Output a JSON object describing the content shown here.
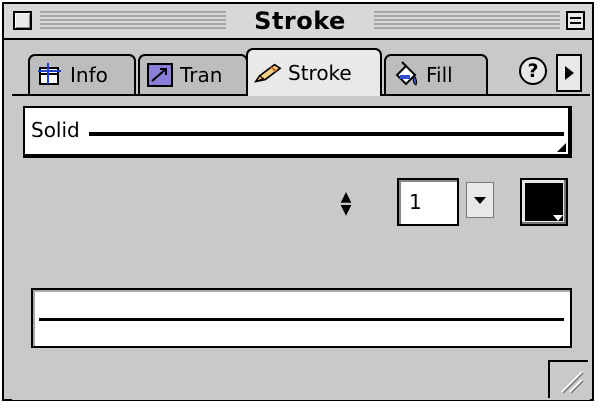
{
  "window": {
    "title": "Stroke"
  },
  "tabs": [
    {
      "label": "Info",
      "icon": "info-grid-icon",
      "active": false
    },
    {
      "label": "Tran",
      "icon": "transform-icon",
      "active": false
    },
    {
      "label": "Stroke",
      "icon": "pen-icon",
      "active": true
    },
    {
      "label": "Fill",
      "icon": "paint-bucket-icon",
      "active": false
    }
  ],
  "help_label": "?",
  "stroke": {
    "style_label": "Solid",
    "width_value": "1",
    "color": "#000000"
  },
  "colors": {
    "panel_bg": "#c9c9c9",
    "field_bg": "#ffffff",
    "border": "#000000"
  }
}
